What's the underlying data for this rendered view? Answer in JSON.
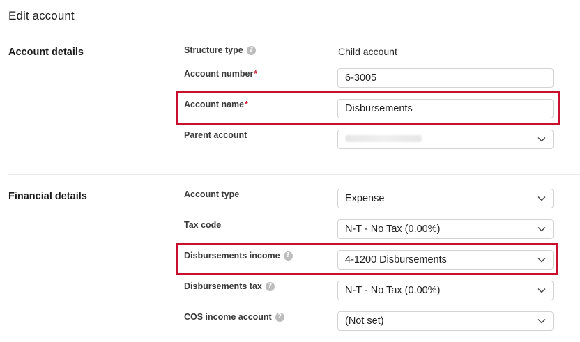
{
  "page": {
    "title": "Edit account"
  },
  "account_details": {
    "title": "Account details",
    "structure_type": {
      "label": "Structure type",
      "value": "Child account"
    },
    "account_number": {
      "label": "Account number",
      "required_mark": "*",
      "value": "6-3005"
    },
    "account_name": {
      "label": "Account name",
      "required_mark": "*",
      "value": "Disbursements"
    },
    "parent_account": {
      "label": "Parent account",
      "value": ""
    }
  },
  "financial_details": {
    "title": "Financial details",
    "account_type": {
      "label": "Account type",
      "value": "Expense"
    },
    "tax_code": {
      "label": "Tax code",
      "value": "N-T - No Tax (0.00%)"
    },
    "disbursements_income": {
      "label": "Disbursements income",
      "value": "4-1200 Disbursements"
    },
    "disbursements_tax": {
      "label": "Disbursements tax",
      "value": "N-T - No Tax (0.00%)"
    },
    "cos_income_account": {
      "label": "COS income account",
      "value": "(Not set)"
    }
  },
  "icons": {
    "help": "?"
  },
  "colors": {
    "highlight": "#c8102e",
    "required": "#c8102e",
    "help_icon": "#bdbdbd",
    "border": "#d3d3d3"
  }
}
